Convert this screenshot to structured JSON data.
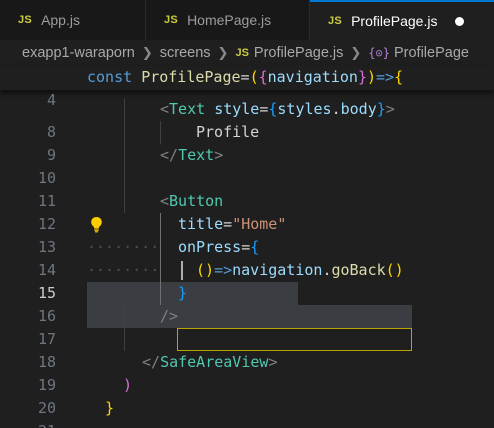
{
  "tabs": [
    {
      "badge": "JS",
      "label": "App.js"
    },
    {
      "badge": "JS",
      "label": "HomePage.js"
    },
    {
      "badge": "JS",
      "label": "ProfilePage.js"
    }
  ],
  "breadcrumb": {
    "project": "exapp1-waraporn",
    "folder": "screens",
    "file_badge": "JS",
    "file": "ProfilePage.js",
    "symbol_icon": "{⊙}",
    "symbol": "ProfilePage"
  },
  "editor": {
    "line_numbers": [
      "4",
      "8",
      "9",
      "10",
      "11",
      "12",
      "13",
      "14",
      "15",
      "16",
      "17",
      "18",
      "19",
      "20",
      "21"
    ],
    "active_line": "15",
    "code": {
      "const_kw": "const",
      "component_name": "ProfilePage",
      "eq_open": "=(",
      "brace_open": "{",
      "nav_param": "navigation",
      "brace_close": "}",
      "arrow": ")=>",
      "body_brace": "{",
      "lt": "<",
      "text_tag": "Text",
      "style_attr": "style",
      "eq": "=",
      "expr_open": "{",
      "styles_obj": "styles",
      "dot": ".",
      "body_prop": "body",
      "expr_close": "}",
      "gt": ">",
      "profile_text": "Profile",
      "close_lt": "</",
      "button_tag": "Button",
      "title_attr": "title",
      "home_str": "\"Home\"",
      "onpress_attr": "onPress",
      "callback_parens": "()",
      "callback_arrow": "=>",
      "navigation_obj": "navigation",
      "goback_fn": "goBack",
      "call_parens": "()",
      "self_close": "/>",
      "safe_area_tag": "SafeAreaView",
      "close_paren": ")",
      "close_brace": "}",
      "whitespace_dots": "········"
    }
  },
  "colors": {
    "background": "#1f1f1f",
    "tab_active_accent": "#0078d4",
    "js_badge": "#cbcb41",
    "keyword": "#569cd6",
    "component": "#4ec9b0",
    "function": "#dcdcaa",
    "variable": "#9cdcfe",
    "string": "#ce9178",
    "bracket_gold": "#ffd700",
    "bracket_orchid": "#da70d6",
    "bracket_blue": "#179fff"
  },
  "icons": {
    "tab_dirty": "modified-dot-icon",
    "breadcrumb_separator": "chevron-right-icon",
    "breadcrumb_symbol": "symbol-variable-icon",
    "code_action": "lightbulb-icon"
  }
}
